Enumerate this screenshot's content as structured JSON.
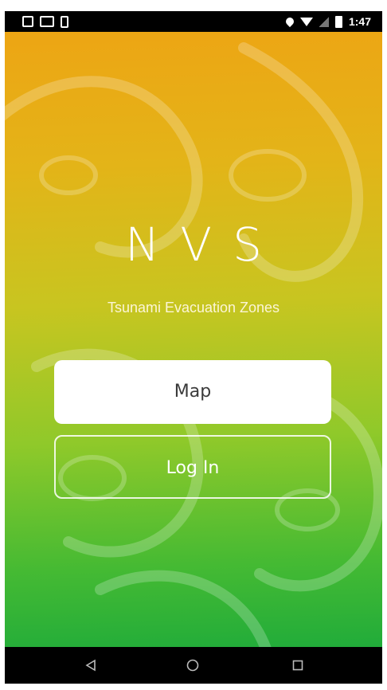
{
  "status_bar": {
    "time": "1:47",
    "left_icons": [
      "message-icon",
      "photo-icon",
      "sim-icon"
    ],
    "right_icons": [
      "location-icon",
      "wifi-icon",
      "signal-icon",
      "battery-icon"
    ]
  },
  "app": {
    "title": "NVS",
    "subtitle": "Tsunami Evacuation Zones",
    "gradient": {
      "top": "#eda514",
      "middle": "#c8c520",
      "bottom": "#21ac3a"
    }
  },
  "buttons": {
    "map_label": "Map",
    "login_label": "Log In"
  },
  "nav_bar": {
    "icons": [
      "back-icon",
      "home-icon",
      "recent-apps-icon"
    ]
  }
}
